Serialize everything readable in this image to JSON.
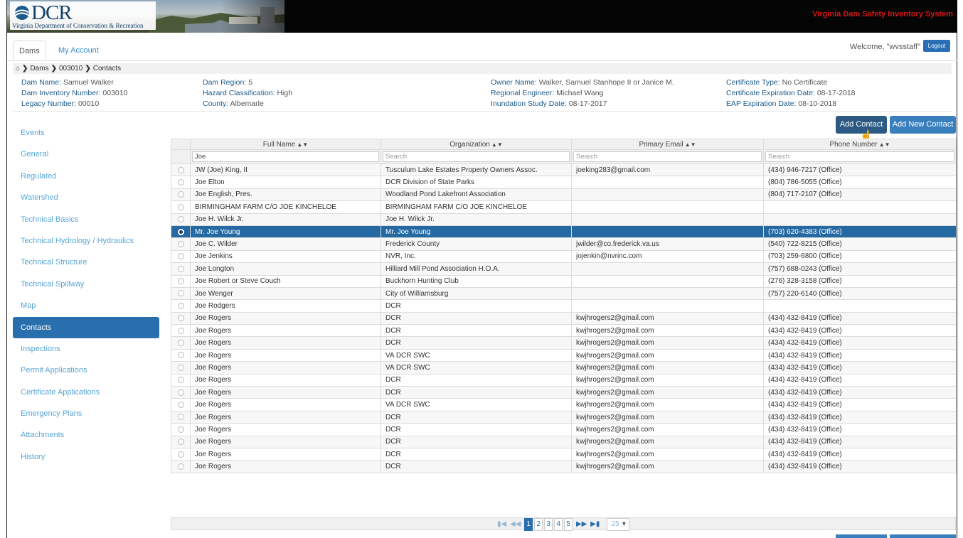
{
  "banner": {
    "logo_text": "DCR",
    "logo_subtitle": "Virginia Department of Conservation & Recreation",
    "system_title": "Virginia Dam Safety Inventory System",
    "accent": "#d01818"
  },
  "header": {
    "tabs": [
      {
        "label": "Dams"
      },
      {
        "label": "My Account"
      }
    ],
    "welcome": "Welcome, \"wvsstaff\"",
    "logout_label": "Logout"
  },
  "breadcrumb": {
    "items": [
      "Dams",
      "003010",
      "Contacts"
    ]
  },
  "dam_info": {
    "col1": [
      {
        "label": "Dam Name:",
        "value": "Samuel Walker"
      },
      {
        "label": "Dam Inventory Number:",
        "value": "003010"
      },
      {
        "label": "Legacy Number:",
        "value": "00010"
      }
    ],
    "col2": [
      {
        "label": "Dam Region:",
        "value": "5"
      },
      {
        "label": "Hazard Classification:",
        "value": "High"
      },
      {
        "label": "County:",
        "value": "Albemarle"
      }
    ],
    "col3": [
      {
        "label": "Owner Name:",
        "value": "Walker, Samuel Stanhope II or Janice M."
      },
      {
        "label": "Regional Engineer:",
        "value": "Michael Wang"
      },
      {
        "label": "Inundation Study Date:",
        "value": "08-17-2017"
      }
    ],
    "col4": [
      {
        "label": "Certificate Type:",
        "value": "No Certificate"
      },
      {
        "label": "Certificate Expiration Date:",
        "value": "08-17-2018"
      },
      {
        "label": "EAP Expiration Date:",
        "value": "08-10-2018"
      }
    ]
  },
  "sidebar": {
    "items": [
      {
        "label": "Events"
      },
      {
        "label": "General"
      },
      {
        "label": "Regulated"
      },
      {
        "label": "Watershed"
      },
      {
        "label": "Technical Basics"
      },
      {
        "label": "Technical Hydrology / Hydraulics"
      },
      {
        "label": "Technical Structure"
      },
      {
        "label": "Technical Spillway"
      },
      {
        "label": "Map"
      },
      {
        "label": "Contacts"
      },
      {
        "label": "Inspections"
      },
      {
        "label": "Permit Applications"
      },
      {
        "label": "Certificate Applications"
      },
      {
        "label": "Emergency Plans"
      },
      {
        "label": "Attachments"
      },
      {
        "label": "History"
      }
    ],
    "active": "Contacts"
  },
  "actions": {
    "add_contact": "Add Contact",
    "add_new_contact": "Add New Contact"
  },
  "grid": {
    "columns": [
      "Full Name",
      "Organization",
      "Primary Email",
      "Phone Number"
    ],
    "filters": {
      "full_name_value": "Joe",
      "placeholder": "Search"
    },
    "rows": [
      {
        "name": "JW (Joe) King, II",
        "org": "Tusculum Lake Estates Property Owners Assoc.",
        "email": "joeking283@gmail.com",
        "phone": "(434) 946-7217 (Office)"
      },
      {
        "name": "Joe Elton",
        "org": "DCR Division of State Parks",
        "email": "",
        "phone": "(804) 786-5055 (Office)"
      },
      {
        "name": "Joe English, Pres.",
        "org": "Woodland Pond Lakefront Association",
        "email": "",
        "phone": "(804) 717-2107 (Office)"
      },
      {
        "name": "BIRMINGHAM FARM C/O JOE KINCHELOE",
        "org": "BIRMINGHAM FARM C/O JOE KINCHELOE",
        "email": "",
        "phone": ""
      },
      {
        "name": "Joe H. Wilck Jr.",
        "org": "Joe H. Wilck Jr.",
        "email": "",
        "phone": ""
      },
      {
        "name": "Mr. Joe Young",
        "org": "Mr. Joe Young",
        "email": "",
        "phone": "(703) 620-4383 (Office)"
      },
      {
        "name": "Joe C. Wilder",
        "org": "Frederick County",
        "email": "jwilder@co.frederick.va.us",
        "phone": "(540) 722-8215 (Office)"
      },
      {
        "name": "Joe Jenkins",
        "org": "NVR, Inc.",
        "email": "jojenkin@nvrinc.com",
        "phone": "(703) 259-6800 (Office)"
      },
      {
        "name": "Joe Longton",
        "org": "Hilliard Mill Pond Association H.O.A.",
        "email": "",
        "phone": "(757) 688-0243 (Office)"
      },
      {
        "name": "Joe Robert or Steve Couch",
        "org": "Buckhorn Hunting Club",
        "email": "",
        "phone": "(276) 328-3158 (Office)"
      },
      {
        "name": "Joe Wenger",
        "org": "City of Williamsburg",
        "email": "",
        "phone": "(757) 220-6140 (Office)"
      },
      {
        "name": "Joe Rodgers",
        "org": "DCR",
        "email": "",
        "phone": ""
      },
      {
        "name": "Joe Rogers",
        "org": "DCR",
        "email": "kwjhrogers2@gmail.com",
        "phone": "(434) 432-8419 (Office)"
      },
      {
        "name": "Joe Rogers",
        "org": "DCR",
        "email": "kwjhrogers2@gmail.com",
        "phone": "(434) 432-8419 (Office)"
      },
      {
        "name": "Joe Rogers",
        "org": "DCR",
        "email": "kwjhrogers2@gmail.com",
        "phone": "(434) 432-8419 (Office)"
      },
      {
        "name": "Joe Rogers",
        "org": "VA DCR SWC",
        "email": "kwjhrogers2@gmail.com",
        "phone": "(434) 432-8419 (Office)"
      },
      {
        "name": "Joe Rogers",
        "org": "VA DCR SWC",
        "email": "kwjhrogers2@gmail.com",
        "phone": "(434) 432-8419 (Office)"
      },
      {
        "name": "Joe Rogers",
        "org": "DCR",
        "email": "kwjhrogers2@gmail.com",
        "phone": "(434) 432-8419 (Office)"
      },
      {
        "name": "Joe Rogers",
        "org": "DCR",
        "email": "kwjhrogers2@gmail.com",
        "phone": "(434) 432-8419 (Office)"
      },
      {
        "name": "Joe Rogers",
        "org": "VA DCR SWC",
        "email": "kwjhrogers2@gmail.com",
        "phone": "(434) 432-8419 (Office)"
      },
      {
        "name": "Joe Rogers",
        "org": "DCR",
        "email": "kwjhrogers2@gmail.com",
        "phone": "(434) 432-8419 (Office)"
      },
      {
        "name": "Joe Rogers",
        "org": "DCR",
        "email": "kwjhrogers2@gmail.com",
        "phone": "(434) 432-8419 (Office)"
      },
      {
        "name": "Joe Rogers",
        "org": "DCR",
        "email": "kwjhrogers2@gmail.com",
        "phone": "(434) 432-8419 (Office)"
      },
      {
        "name": "Joe Rogers",
        "org": "DCR",
        "email": "kwjhrogers2@gmail.com",
        "phone": "(434) 432-8419 (Office)"
      },
      {
        "name": "Joe Rogers",
        "org": "DCR",
        "email": "kwjhrogers2@gmail.com",
        "phone": "(434) 432-8419 (Office)"
      }
    ],
    "selected_index": 5
  },
  "pager": {
    "pages": [
      "1",
      "2",
      "3",
      "4",
      "5"
    ],
    "current": "1",
    "page_size": "25"
  },
  "colors": {
    "selected_row": "#2569a3",
    "sidebar_active": "#2a6fad",
    "link": "#5aa6d6"
  }
}
